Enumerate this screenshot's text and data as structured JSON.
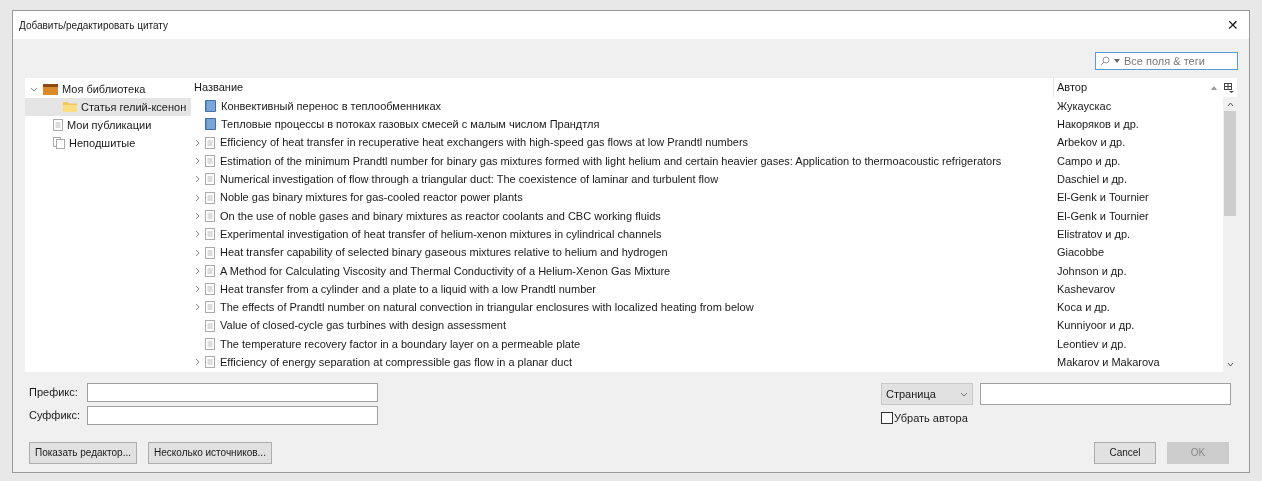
{
  "window": {
    "title": "Добавить/редактировать цитату",
    "close": "✕"
  },
  "search": {
    "placeholder": "Все поля & теги"
  },
  "sidebar": {
    "items": [
      {
        "label": "Моя библиотека",
        "kind": "library",
        "selected": false,
        "expanded": true,
        "children": [
          {
            "label": "Статья гелий-ксенон",
            "kind": "folder",
            "selected": true
          }
        ]
      },
      {
        "label": "Мои публикации",
        "kind": "document",
        "selected": false
      },
      {
        "label": "Неподшитые",
        "kind": "unfiled",
        "selected": false
      }
    ]
  },
  "table": {
    "columns": [
      "Название",
      "Автор"
    ],
    "rows": [
      {
        "kind": "book",
        "expandable": false,
        "title": "Конвективный перенос в теплообменниках",
        "author": "Жукаускас"
      },
      {
        "kind": "book",
        "expandable": false,
        "title": "Тепловые процессы в потоках газовых смесей с малым числом Прандтля",
        "author": "Накоряков и др."
      },
      {
        "kind": "article",
        "expandable": true,
        "title": "Efficiency of heat transfer in recuperative heat exchangers with high-speed gas flows at low Prandtl numbers",
        "author": "Arbekov и др."
      },
      {
        "kind": "article",
        "expandable": true,
        "title": "Estimation of the minimum Prandtl number for binary gas mixtures formed with light helium and certain heavier gases: Application to thermoacoustic refrigerators",
        "author": "Campo и др."
      },
      {
        "kind": "article",
        "expandable": true,
        "title": "Numerical investigation of flow through a triangular duct: The coexistence of laminar and turbulent flow",
        "author": "Daschiel и др."
      },
      {
        "kind": "article",
        "expandable": true,
        "title": "Noble gas binary mixtures for gas-cooled reactor power plants",
        "author": "El-Genk и Tournier"
      },
      {
        "kind": "article",
        "expandable": true,
        "title": "On the use of noble gases and binary mixtures as reactor coolants and CBC working fluids",
        "author": "El-Genk и Tournier"
      },
      {
        "kind": "article",
        "expandable": true,
        "title": "Experimental investigation of heat transfer of helium-xenon mixtures in cylindrical channels",
        "author": "Elistratov и др."
      },
      {
        "kind": "article",
        "expandable": true,
        "title": "Heat transfer capability of selected binary gaseous mixtures relative to helium and hydrogen",
        "author": "Giacobbe"
      },
      {
        "kind": "article",
        "expandable": true,
        "title": "A Method for Calculating Viscosity and Thermal Conductivity of a Helium-Xenon Gas Mixture",
        "author": "Johnson и др."
      },
      {
        "kind": "article",
        "expandable": true,
        "title": "Heat transfer from a cylinder and a plate to a liquid with a low Prandtl number",
        "author": "Kashevarov"
      },
      {
        "kind": "article",
        "expandable": true,
        "title": "The effects of Prandtl number on natural convection in triangular enclosures with localized heating from below",
        "author": "Koca и др."
      },
      {
        "kind": "article",
        "expandable": false,
        "title": "Value of closed-cycle gas turbines with design assessment",
        "author": "Kunniyoor и др."
      },
      {
        "kind": "article",
        "expandable": false,
        "title": "The temperature recovery factor in a boundary layer on a permeable plate",
        "author": "Leontiev и др."
      },
      {
        "kind": "article",
        "expandable": true,
        "title": "Efficiency of energy separation at compressible gas flow in a planar duct",
        "author": "Makarov и Makarova"
      }
    ]
  },
  "prefix": {
    "label": "Префикс:"
  },
  "suffix": {
    "label": "Суффикс:"
  },
  "locator": {
    "value": "Страница"
  },
  "suppress_author": {
    "label": "Убрать автора",
    "checked": false
  },
  "buttons": [
    {
      "label": "Показать редактор...",
      "disabled": false
    },
    {
      "label": "Несколько источников...",
      "disabled": false
    },
    {
      "label": "Cancel",
      "disabled": false
    },
    {
      "label": "OK",
      "disabled": true
    }
  ]
}
